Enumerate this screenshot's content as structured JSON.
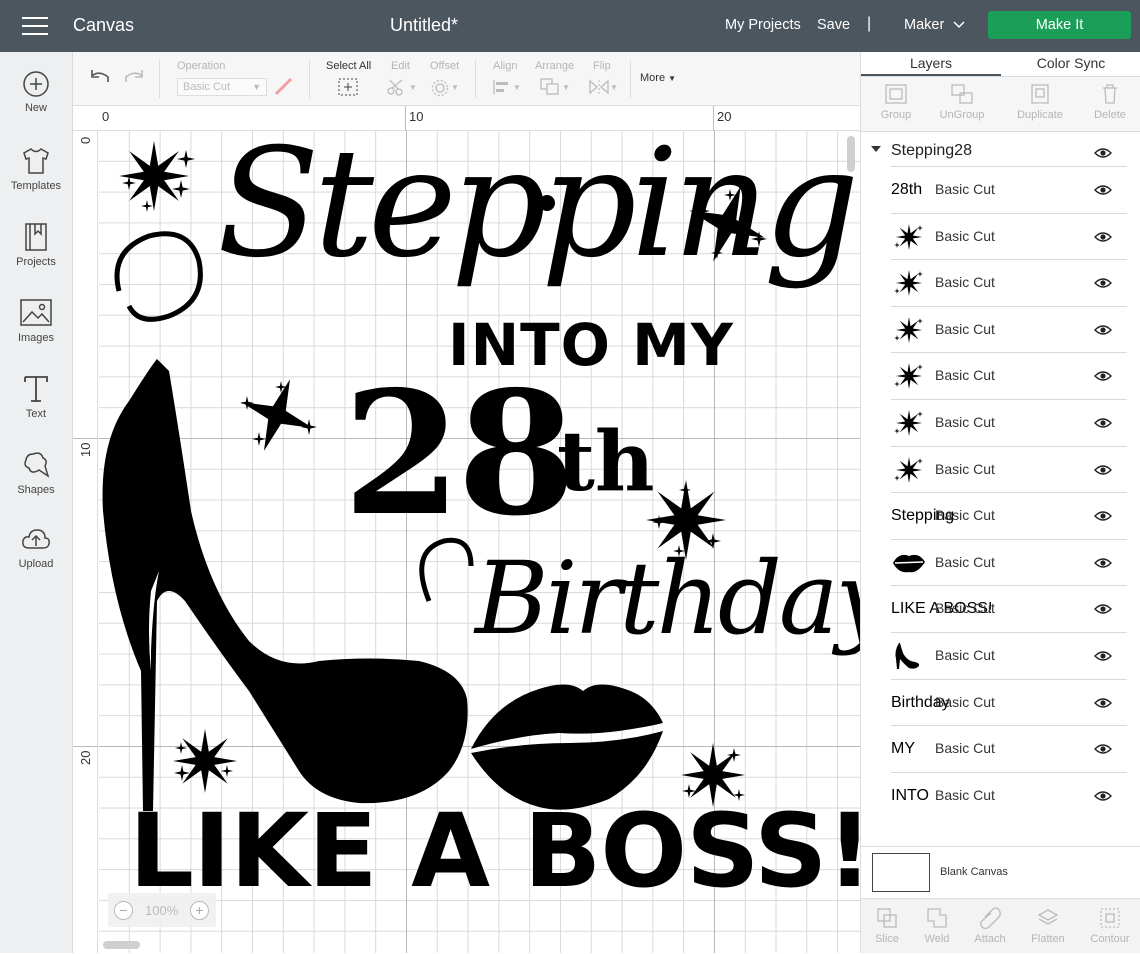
{
  "topbar": {
    "app_title": "Canvas",
    "doc_title": "Untitled*",
    "my_projects": "My Projects",
    "save": "Save",
    "separator": "|",
    "machine": "Maker",
    "make_it": "Make It"
  },
  "leftnav": {
    "items": [
      {
        "label": "New",
        "icon": "plus-circle-icon"
      },
      {
        "label": "Templates",
        "icon": "tshirt-icon"
      },
      {
        "label": "Projects",
        "icon": "bookmark-book-icon"
      },
      {
        "label": "Images",
        "icon": "image-icon"
      },
      {
        "label": "Text",
        "icon": "text-t-icon"
      },
      {
        "label": "Shapes",
        "icon": "shapes-icon"
      },
      {
        "label": "Upload",
        "icon": "cloud-upload-icon"
      }
    ]
  },
  "toolbar": {
    "operation_label": "Operation",
    "operation_value": "Basic Cut",
    "select_all": "Select All",
    "edit": "Edit",
    "offset": "Offset",
    "align": "Align",
    "arrange": "Arrange",
    "flip": "Flip",
    "more": "More"
  },
  "ruler": {
    "top": [
      "0",
      "10",
      "20"
    ],
    "left": [
      "0",
      "10",
      "20"
    ]
  },
  "design": {
    "line1": "Stepping",
    "line2": "INTO MY",
    "line3_num": "28",
    "line3_sup": "th",
    "line4": "Birthday",
    "line5": "LIKE A BOSS!"
  },
  "zoom": {
    "minus": "−",
    "value": "100%",
    "plus": "+"
  },
  "rightpanel": {
    "tabs": [
      "Layers",
      "Color Sync"
    ],
    "tools": [
      "Group",
      "UnGroup",
      "Duplicate",
      "Delete"
    ],
    "group_name": "Stepping28",
    "layers": [
      {
        "name": "Basic Cut",
        "thumb": "28th"
      },
      {
        "name": "Basic Cut",
        "thumb": "star"
      },
      {
        "name": "Basic Cut",
        "thumb": "star"
      },
      {
        "name": "Basic Cut",
        "thumb": "star"
      },
      {
        "name": "Basic Cut",
        "thumb": "star"
      },
      {
        "name": "Basic Cut",
        "thumb": "star"
      },
      {
        "name": "Basic Cut",
        "thumb": "star"
      },
      {
        "name": "Basic Cut",
        "thumb": "Stepping"
      },
      {
        "name": "Basic Cut",
        "thumb": "lips"
      },
      {
        "name": "Basic Cut",
        "thumb": "LIKE A BOSS!"
      },
      {
        "name": "Basic Cut",
        "thumb": "shoe"
      },
      {
        "name": "Basic Cut",
        "thumb": "Birthday"
      },
      {
        "name": "Basic Cut",
        "thumb": "MY"
      },
      {
        "name": "Basic Cut",
        "thumb": "INTO"
      }
    ],
    "blank_canvas": "Blank Canvas",
    "bottom_tools": [
      "Slice",
      "Weld",
      "Attach",
      "Flatten",
      "Contour"
    ]
  },
  "colors": {
    "topbar_bg": "#4c565e",
    "make_it_green": "#1a9e58",
    "design_black": "#000000"
  }
}
